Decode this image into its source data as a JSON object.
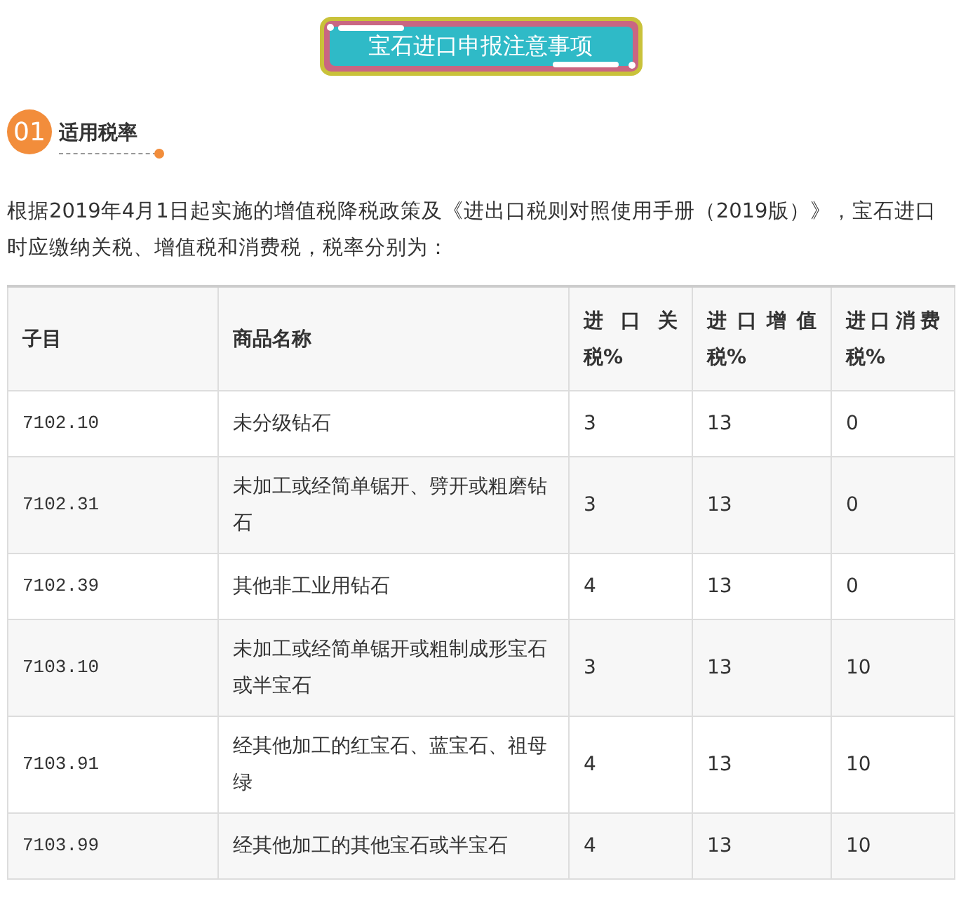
{
  "banner": {
    "title": "宝石进口申报注意事项"
  },
  "section": {
    "number": "01",
    "title": "适用税率"
  },
  "intro": "根据2019年4月1日起实施的增值税降税政策及《进出口税则对照使用手册（2019版）》，宝石进口时应缴纳关税、增值税和消费税，税率分别为：",
  "table": {
    "columns": [
      "子目",
      "商品名称",
      "进口关税%",
      "进口增值税%",
      "进口消费税%"
    ],
    "rows": [
      [
        "7102.10",
        "未分级钻石",
        "3",
        "13",
        "0"
      ],
      [
        "7102.31",
        "未加工或经简单锯开、劈开或粗磨钻石",
        "3",
        "13",
        "0"
      ],
      [
        "7102.39",
        "其他非工业用钻石",
        "4",
        "13",
        "0"
      ],
      [
        "7103.10",
        "未加工或经简单锯开或粗制成形宝石或半宝石",
        "3",
        "13",
        "10"
      ],
      [
        "7103.91",
        "经其他加工的红宝石、蓝宝石、祖母绿",
        "4",
        "13",
        "10"
      ],
      [
        "7103.99",
        "经其他加工的其他宝石或半宝石",
        "4",
        "13",
        "10"
      ]
    ]
  }
}
